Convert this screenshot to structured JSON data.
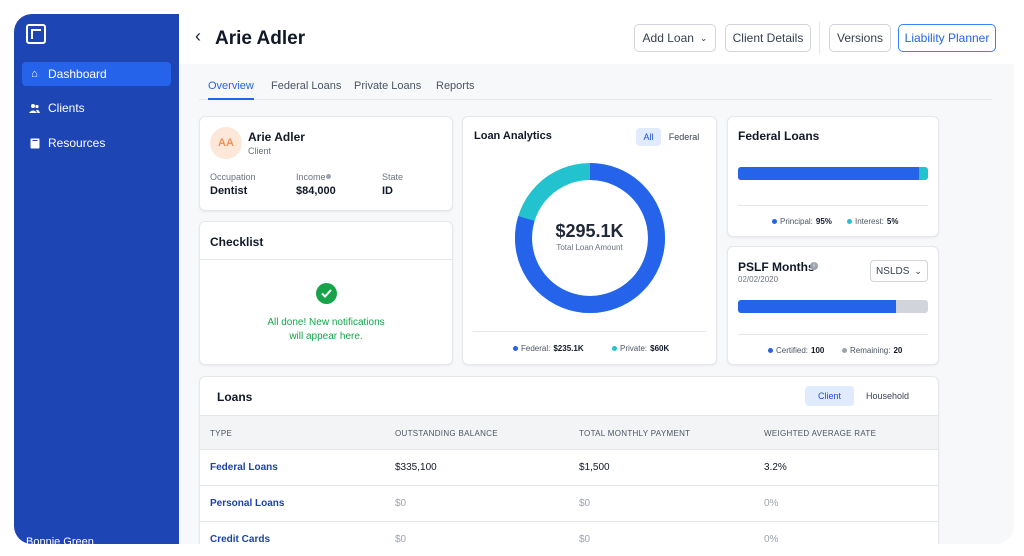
{
  "sidebar": {
    "items": [
      {
        "label": "Dashboard",
        "icon": "home-icon"
      },
      {
        "label": "Clients",
        "icon": "users-icon"
      },
      {
        "label": "Resources",
        "icon": "book-icon"
      }
    ],
    "user": "Bonnie Green"
  },
  "header": {
    "title": "Arie Adler",
    "buttons": {
      "add_loan": "Add Loan",
      "client_details": "Client Details",
      "versions": "Versions",
      "liability_planner": "Liability Planner"
    }
  },
  "tabs": [
    "Overview",
    "Federal Loans",
    "Private Loans",
    "Reports"
  ],
  "client": {
    "initials": "AA",
    "name": "Arie Adler",
    "role": "Client",
    "occupation_label": "Occupation",
    "occupation": "Dentist",
    "income_label": "Income",
    "income": "$84,000",
    "state_label": "State",
    "state": "ID"
  },
  "checklist": {
    "title": "Checklist",
    "message_line1": "All done! New notifications",
    "message_line2": "will appear here."
  },
  "analytics": {
    "title": "Loan Analytics",
    "toggle": [
      "All",
      "Federal"
    ],
    "total": "$295.1K",
    "total_label": "Total Loan Amount",
    "federal_label": "Federal:",
    "federal_value": "$235.1K",
    "private_label": "Private:",
    "private_value": "$60K",
    "federal_share": 0.797
  },
  "federal_loans": {
    "title": "Federal Loans",
    "principal_label": "Principal:",
    "principal": "95%",
    "interest_label": "Interest:",
    "interest": "5%",
    "principal_fraction": 0.95
  },
  "pslf": {
    "title": "PSLF Months",
    "date": "02/02/2020",
    "dropdown": "NSLDS",
    "certified_label": "Certified:",
    "certified": "100",
    "remaining_label": "Remaining:",
    "remaining": "20",
    "certified_fraction": 0.833
  },
  "loans": {
    "title": "Loans",
    "toggle": [
      "Client",
      "Household"
    ],
    "columns": [
      "TYPE",
      "OUTSTANDING BALANCE",
      "TOTAL MONTHLY PAYMENT",
      "WEIGHTED AVERAGE RATE"
    ],
    "rows": [
      {
        "type": "Federal Loans",
        "balance": "$335,100",
        "payment": "$1,500",
        "rate": "3.2%"
      },
      {
        "type": "Personal Loans",
        "balance": "$0",
        "payment": "$0",
        "rate": "0%"
      },
      {
        "type": "Credit Cards",
        "balance": "$0",
        "payment": "$0",
        "rate": "0%"
      }
    ]
  },
  "colors": {
    "sidebar": "#1e45b4",
    "primary": "#2563eb",
    "teal": "#22c3cf",
    "success": "#16a34a",
    "grey": "#d1d5db"
  }
}
